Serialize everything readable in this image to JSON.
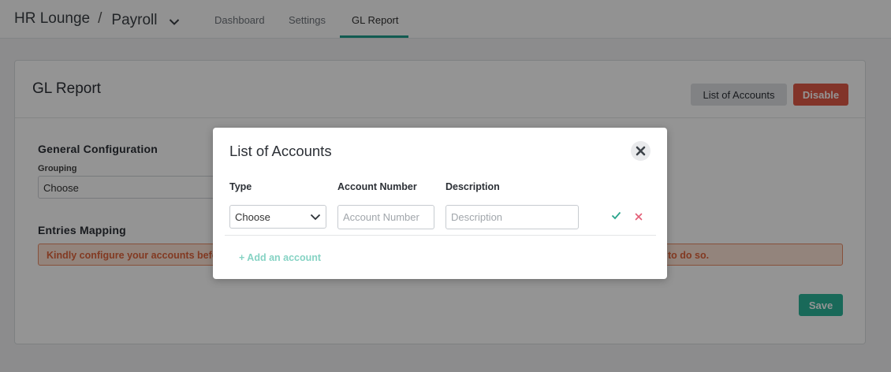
{
  "header": {
    "workspace": "HR Lounge",
    "separator": "/",
    "module": "Payroll",
    "tabs": [
      {
        "label": "Dashboard",
        "active": false
      },
      {
        "label": "Settings",
        "active": false
      },
      {
        "label": "GL Report",
        "active": true
      }
    ]
  },
  "page": {
    "title": "GL Report",
    "list_accounts_label": "List of Accounts",
    "disable_label": "Disable",
    "general_configuration": {
      "title": "General Configuration",
      "grouping_label": "Grouping",
      "grouping_value": "Choose"
    },
    "entries_mapping": {
      "title": "Entries Mapping",
      "alert_start": "Kindly configure your accounts befor",
      "alert_end": "to do so."
    },
    "save_label": "Save"
  },
  "modal": {
    "title": "List of Accounts",
    "columns": [
      "Type",
      "Account Number",
      "Description"
    ],
    "row": {
      "type_value": "Choose",
      "account_placeholder": "Account Number",
      "description_placeholder": "Description"
    },
    "add_account_label": "+ Add an account"
  },
  "icons": {
    "module_dropdown": "chevron-down-icon",
    "close": "close-icon",
    "select_arrow": "chevron-down-icon",
    "confirm": "check-icon",
    "delete": "x-icon"
  },
  "colors": {
    "accent": "#1f9e8c",
    "danger": "#e05a47",
    "save": "#2bb59a",
    "alert_text": "#e0643c",
    "confirm_icon": "#2aa58c",
    "delete_icon": "#e35d75"
  }
}
